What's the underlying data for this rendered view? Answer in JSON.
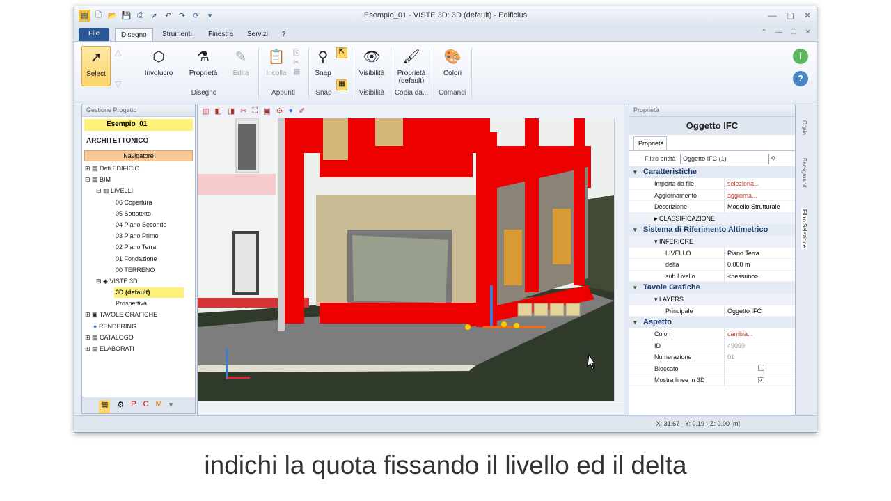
{
  "window": {
    "title": "Esempio_01 - VISTE 3D: 3D (default) - Edificius"
  },
  "menu": {
    "file": "File",
    "tabs": [
      "Disegno",
      "Strumenti",
      "Finestra",
      "Servizi",
      "?"
    ]
  },
  "ribbon": {
    "buttons": {
      "select": "Select",
      "involucro": "Involucro",
      "proprieta": "Proprietà",
      "edita": "Edita",
      "incolla": "Incolla",
      "snap": "Snap",
      "visibilita": "Visibilità",
      "proprieta_default": "Proprietà (default)",
      "colori": "Colori"
    },
    "groups": {
      "disegno": "Disegno",
      "appunti": "Appunti",
      "snap": "Snap",
      "visibilita": "Visibilità",
      "copia": "Copia da...",
      "comandi": "Comandi"
    }
  },
  "left_panel": {
    "header": "Gestione Progetto",
    "project": "Esempio_01",
    "section": "ARCHITETTONICO",
    "navigator": "Navigatore",
    "tree": [
      "Dati EDIFICIO",
      "BIM",
      "LIVELLI",
      "06 Copertura",
      "05 Sottotetto",
      "04 Piano Secondo",
      "03 Piano Primo",
      "02 Piano Terra",
      "01 Fondazione",
      "00 TERRENO",
      "VISTE 3D",
      "3D (default)",
      "Prospettiva",
      "TAVOLE GRAFICHE",
      "RENDERING",
      "CATALOGO",
      "ELABORATI"
    ]
  },
  "props": {
    "header": "Proprietà",
    "title": "Oggetto IFC",
    "tab": "Proprietà",
    "filter_label": "Filtro entità",
    "filter_value": "Oggetto IFC (1)",
    "caratteristiche": "Caratteristiche",
    "importa_k": "Importa da file",
    "importa_v": "seleziona...",
    "aggiorna_k": "Aggiornamento",
    "aggiorna_v": "aggiorna...",
    "descr_k": "Descrizione",
    "descr_v": "Modello Strutturale",
    "classificazione": "CLASSIFICAZIONE",
    "sistema": "Sistema di Riferimento Altimetrico",
    "inferiore": "INFERIORE",
    "livello_k": "LIVELLO",
    "livello_v": "Piano Terra",
    "delta_k": "delta",
    "delta_v": "0.000 m",
    "sublivello_k": "sub Livello",
    "sublivello_v": "<nessuno>",
    "tavole": "Tavole Grafiche",
    "layers": "LAYERS",
    "principale_k": "Principale",
    "principale_v": "Oggetto IFC",
    "aspetto": "Aspetto",
    "colori_k": "Colori",
    "colori_v": "cambia...",
    "id_k": "ID",
    "id_v": "49099",
    "num_k": "Numerazione",
    "num_v": "01",
    "bloccato_k": "Bloccato",
    "mostra_k": "Mostra linee in 3D"
  },
  "side_tabs": [
    "Copia",
    "Background",
    "Filtro Selezione"
  ],
  "status": {
    "coords": "X: 31.67 - Y: 0.19 - Z: 0.00 [m]"
  },
  "caption": "indichi la quota fissando il livello ed il delta"
}
